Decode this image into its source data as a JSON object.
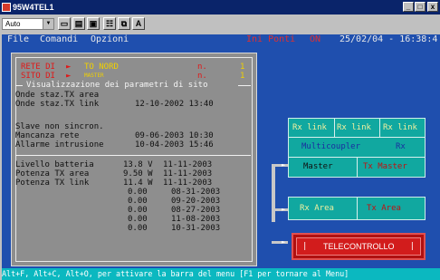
{
  "window": {
    "title": "95W4TEL1",
    "controls": [
      "_",
      "□",
      "x"
    ]
  },
  "toolbar": {
    "font_select": "Auto",
    "letter_button": "A"
  },
  "menu": {
    "file": "File",
    "comandi": "Comandi",
    "opzioni": "Opzioni",
    "ini_ponti": "Ini Ponti",
    "on": "ON",
    "datetime": "25/02/04 - 16:38:4"
  },
  "site": {
    "rete_label": "RETE DI",
    "rete_value": "TO NORD",
    "rete_n_label": "n.",
    "rete_n": "1",
    "sito_label": "SITO DI",
    "sito_value": "MASTER",
    "sito_n_label": "n.",
    "sito_n": "1",
    "section_title": "Visualizzazione dei parametri di sito"
  },
  "params": {
    "onde_area": "Onde staz.TX area",
    "onde_link": "Onde staz.TX link",
    "onde_link_date": "12-10-2002 13:40",
    "slave": "Slave non sincron.",
    "mancanza": "Mancanza rete",
    "mancanza_date": "09-06-2003 10:30",
    "allarme": "Allarme intrusione",
    "allarme_date": "10-04-2003 15:46"
  },
  "measures": [
    {
      "label": "Livello batteria",
      "value": "13.8 V",
      "date": "11-11-2003"
    },
    {
      "label": "Potenza TX area",
      "value": "9.50 W",
      "date": "11-11-2003"
    },
    {
      "label": "Potenza TX link",
      "value": "11.4 W",
      "date": "11-11-2003"
    },
    {
      "label": "",
      "value": "0.00",
      "date": "08-31-2003"
    },
    {
      "label": "",
      "value": "0.00",
      "date": "09-20-2003"
    },
    {
      "label": "",
      "value": "0.00",
      "date": "08-27-2003"
    },
    {
      "label": "",
      "value": "0.00",
      "date": "11-08-2003"
    },
    {
      "label": "",
      "value": "0.00",
      "date": "10-31-2003"
    }
  ],
  "diagram": {
    "rx_link_1": "Rx link",
    "rx_link_2": "Rx link",
    "rx_link_3": "Rx link",
    "multicoupler": "Multicoupler",
    "rx": "Rx",
    "master": "Master",
    "tx_master": "Tx Master",
    "rx_area": "Rx  Area",
    "tx_area": "Tx  Area",
    "telecontrollo": "TELECONTROLLO",
    "tele_left": "|",
    "tele_right": "|"
  },
  "status": {
    "text": "Alt+F, Alt+C, Alt+O, per attivare la barra del menu [F1 per tornare al Menu]"
  },
  "colors": {
    "terminal_bg": "#1f4fae",
    "panel_bg": "#8e8e8e",
    "teal": "#11a8a0",
    "status_bg": "#0bb8c0",
    "alarm_red": "#d21c1c"
  }
}
